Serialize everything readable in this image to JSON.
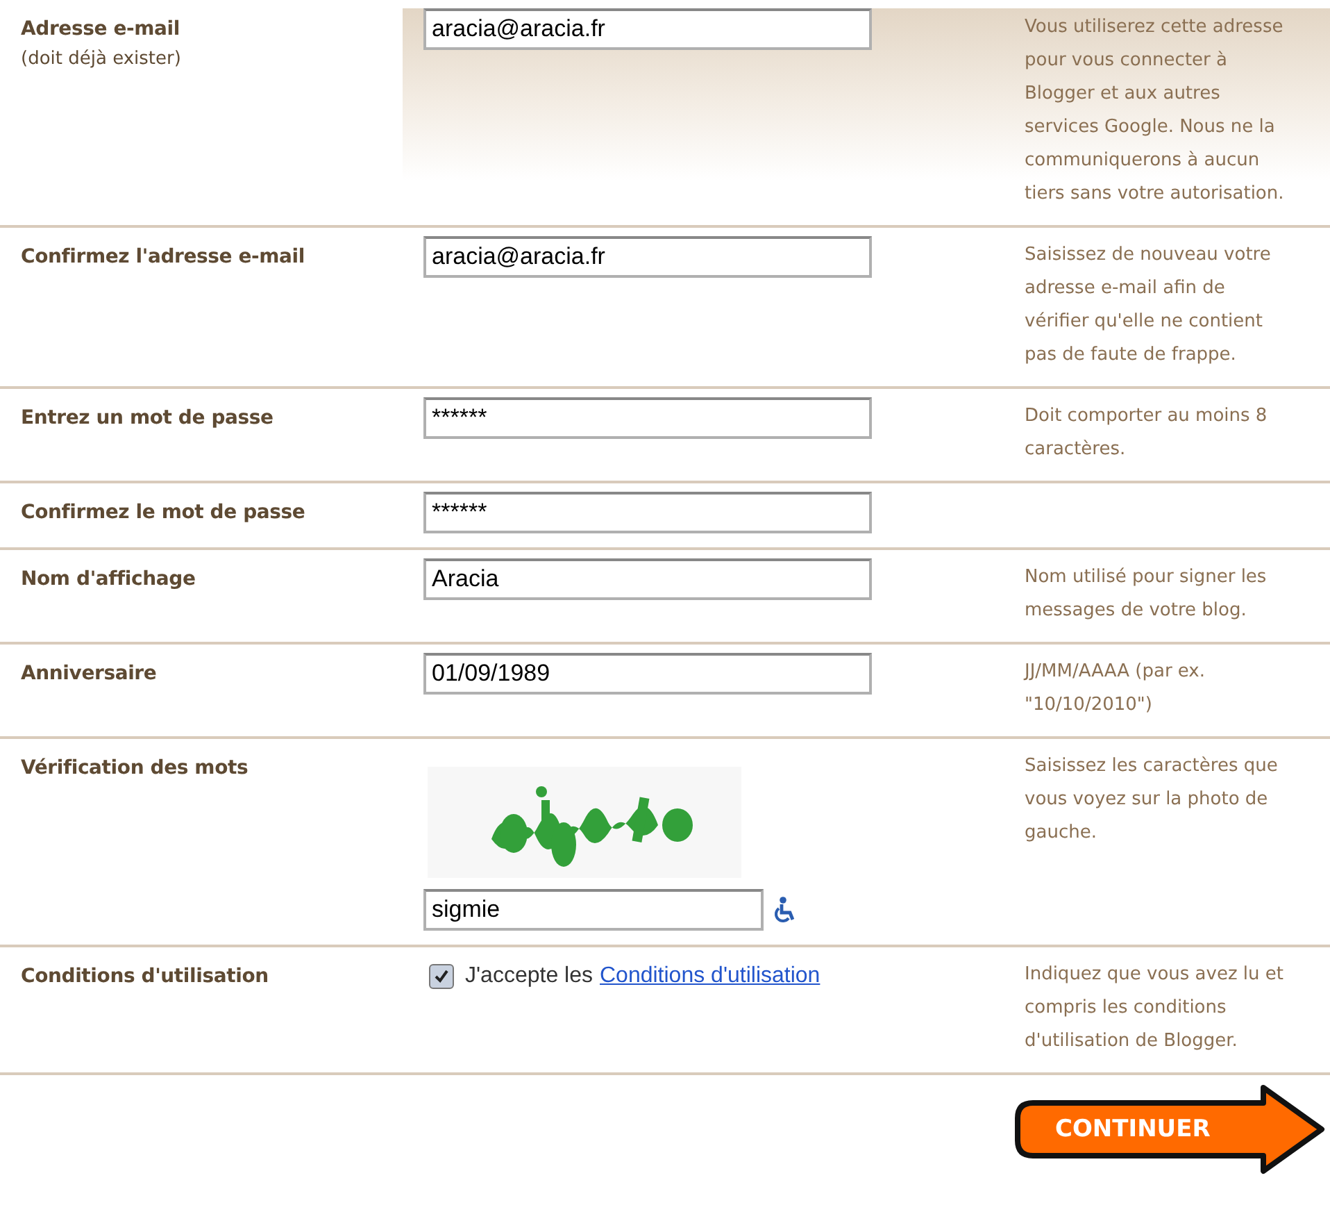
{
  "rows": [
    {
      "kind": "text",
      "label": "Adresse e-mail",
      "sublabel": "(doit déjà exister)",
      "value": "aracia@aracia.fr",
      "hint": "Vous utiliserez cette adresse pour vous connecter à Blogger et aux autres services Google. Nous ne la communiquerons à aucun tiers sans votre autorisation.",
      "highlighted": true
    },
    {
      "kind": "text",
      "label": "Confirmez l'adresse e-mail",
      "value": "aracia@aracia.fr",
      "hint": "Saisissez de nouveau votre adresse e-mail afin de vérifier qu'elle ne contient pas de faute de frappe.",
      "highlighted": false
    },
    {
      "kind": "text",
      "label": "Entrez un mot de passe",
      "value": "******",
      "hint": "Doit comporter au moins 8 caractères.",
      "highlighted": false
    },
    {
      "kind": "text",
      "label": "Confirmez le mot de passe",
      "value": "******",
      "highlighted": false
    },
    {
      "kind": "text",
      "label": "Nom d'affichage",
      "value": "Aracia",
      "hint": "Nom utilisé pour signer les messages de votre blog.",
      "highlighted": false
    },
    {
      "kind": "text",
      "label": "Anniversaire",
      "value": "01/09/1989",
      "hint": "JJ/MM/AAAA (par ex. \"10/10/2010\")",
      "highlighted": false
    },
    {
      "kind": "captcha",
      "label": "Vérification des mots",
      "value": "sigmie",
      "hint": "Saisissez les caractères que vous voyez sur la photo de gauche.",
      "highlighted": false
    },
    {
      "kind": "checkbox",
      "label": "Conditions d'utilisation",
      "checked": true,
      "text": "J'accepte les",
      "link": "Conditions d'utilisation",
      "hint": "Indiquez que vous avez lu et compris les conditions d'utilisation de Blogger.",
      "highlighted": false
    }
  ],
  "submit": {
    "label": "CONTINUER"
  }
}
